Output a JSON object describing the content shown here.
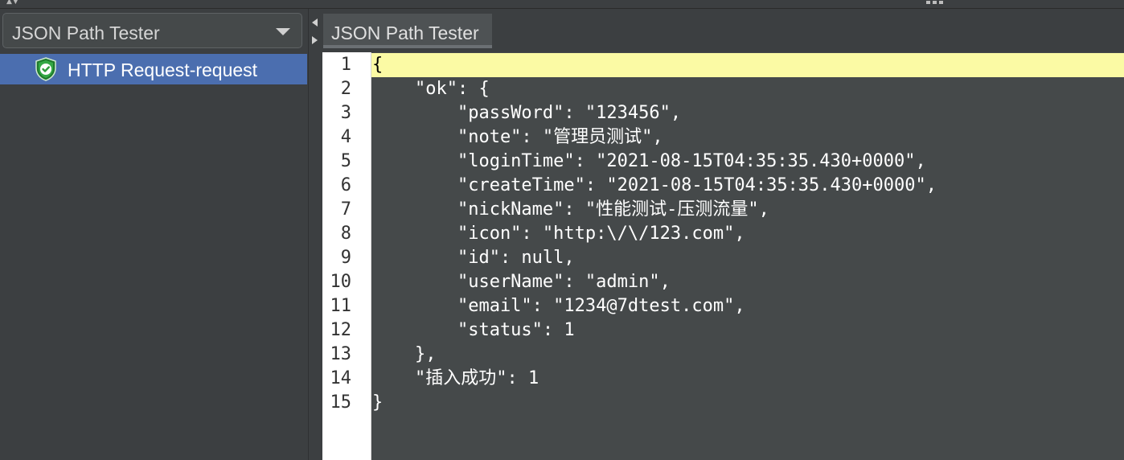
{
  "left_panel": {
    "dropdown_value": "JSON Path Tester",
    "tree_items": [
      {
        "label": "HTTP Request-request",
        "icon": "shield-check-icon",
        "selected": true
      }
    ]
  },
  "right_panel": {
    "tab_label": "JSON Path Tester",
    "line_numbers": [
      "1",
      "2",
      "3",
      "4",
      "5",
      "6",
      "7",
      "8",
      "9",
      "10",
      "11",
      "12",
      "13",
      "14",
      "15"
    ],
    "code_lines": [
      "{",
      "    \"ok\": {",
      "        \"passWord\": \"123456\",",
      "        \"note\": \"管理员测试\",",
      "        \"loginTime\": \"2021-08-15T04:35:35.430+0000\",",
      "        \"createTime\": \"2021-08-15T04:35:35.430+0000\",",
      "        \"nickName\": \"性能测试-压测流量\",",
      "        \"icon\": \"http:\\/\\/123.com\",",
      "        \"id\": null,",
      "        \"userName\": \"admin\",",
      "        \"email\": \"1234@7dtest.com\",",
      "        \"status\": 1",
      "    },",
      "    \"插入成功\": 1",
      "}"
    ],
    "current_line_index": 0
  },
  "colors": {
    "background": "#3c3f41",
    "selection": "#4b6eaf",
    "current_line": "#fbfaa4",
    "editor_bg": "#45494a",
    "shield_green": "#2e9c3b"
  }
}
